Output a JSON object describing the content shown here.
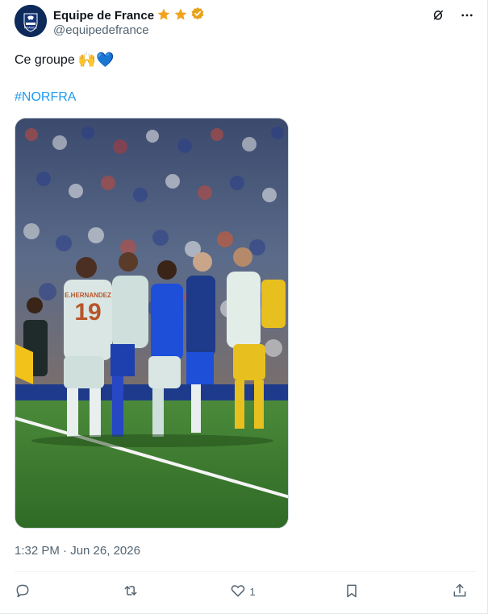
{
  "author": {
    "display_name": "Equipe de France",
    "handle": "@equipedefrance",
    "avatar_label": "FRANCE",
    "badges": [
      "star-icon",
      "star-icon",
      "verified-badge-icon"
    ],
    "badge_color": "#f1a31f",
    "verified_color": "#e8a21a"
  },
  "header_icons": [
    "grok-icon",
    "more-icon"
  ],
  "tweet": {
    "text": "Ce groupe",
    "emojis": "🙌💙",
    "hashtag": "#NORFRA",
    "media": {
      "description_icon": "team-celebration-photo",
      "shirt_name": "E.HERNANDEZ",
      "shirt_number": "19"
    },
    "timestamp": "1:32 PM · Jun 26, 2026"
  },
  "actions": {
    "reply": {
      "icon": "reply-icon",
      "count": ""
    },
    "repost": {
      "icon": "repost-icon",
      "count": ""
    },
    "like": {
      "icon": "heart-icon",
      "count": "1"
    },
    "bookmark": {
      "icon": "bookmark-icon",
      "count": ""
    },
    "share": {
      "icon": "share-icon",
      "count": ""
    }
  },
  "colors": {
    "text": "#0f1419",
    "muted": "#536471",
    "link": "#1d9bf0",
    "pitch": "#3a7a2e"
  }
}
